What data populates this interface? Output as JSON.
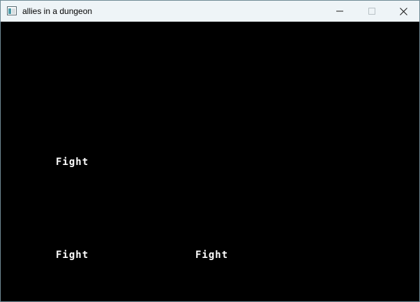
{
  "window": {
    "title": "allies in a dungeon",
    "icon": "app-window-icon",
    "controls": [
      "minimize-icon",
      "maximize-icon",
      "close-icon"
    ],
    "colors": {
      "titlebar": "#eef4f7",
      "background": "#000000",
      "text": "#ffffff"
    }
  },
  "game": {
    "options": [
      {
        "label": "Fight"
      },
      {
        "label": "Fight"
      },
      {
        "label": "Fight"
      }
    ]
  }
}
